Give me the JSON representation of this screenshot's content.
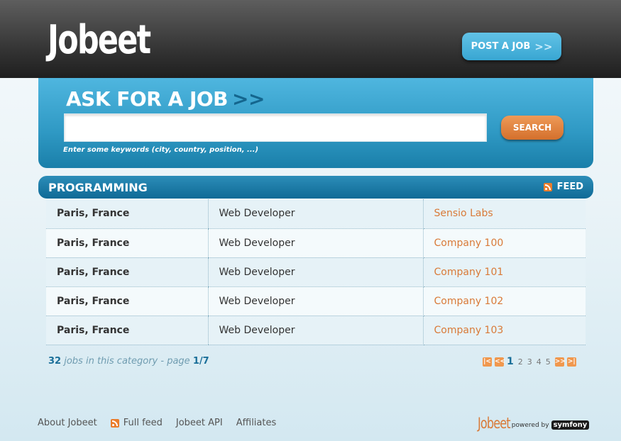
{
  "header": {
    "logo_text": "Jobeet",
    "post_button": "POST A JOB",
    "post_arrow": ">>"
  },
  "search": {
    "title": "ASK FOR A JOB",
    "title_arrow": ">>",
    "input_value": "",
    "hint": "Enter some keywords (city, country, position, ...)",
    "button": "SEARCH"
  },
  "category": {
    "title": "PROGRAMMING",
    "feed_label": "FEED"
  },
  "jobs": [
    {
      "location": "Paris, France",
      "position": "Web Developer",
      "company": "Sensio Labs"
    },
    {
      "location": "Paris, France",
      "position": "Web Developer",
      "company": "Company 100"
    },
    {
      "location": "Paris, France",
      "position": "Web Developer",
      "company": "Company 101"
    },
    {
      "location": "Paris, France",
      "position": "Web Developer",
      "company": "Company 102"
    },
    {
      "location": "Paris, France",
      "position": "Web Developer",
      "company": "Company 103"
    }
  ],
  "summary": {
    "count": "32",
    "text": "jobs in this category - page",
    "page": "1/7"
  },
  "pagination": {
    "first": "|<",
    "prev": "<<",
    "pages": [
      "1",
      "2",
      "3",
      "4",
      "5"
    ],
    "next": ">>",
    "last": ">|"
  },
  "footer": {
    "about": "About Jobeet",
    "full_feed": "Full feed",
    "api": "Jobeet API",
    "affiliates": "Affiliates",
    "logo_small": "Jobeet",
    "powered_by": "powered by",
    "symfony": "symfony"
  },
  "colors": {
    "accent_blue": "#38a6d2",
    "accent_orange": "#d97a38",
    "header_dark": "#303030"
  }
}
